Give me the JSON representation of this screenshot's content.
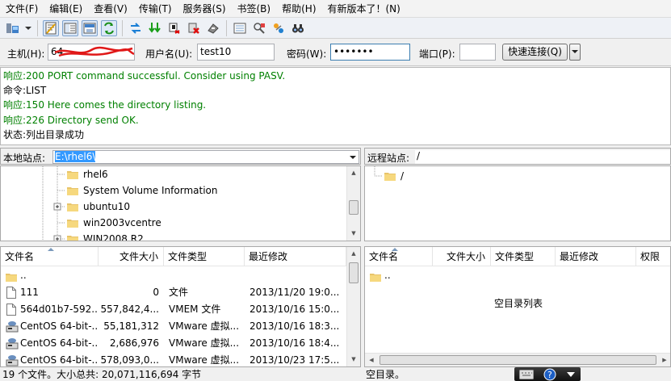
{
  "menu": [
    "文件(F)",
    "编辑(E)",
    "查看(V)",
    "传输(T)",
    "服务器(S)",
    "书签(B)",
    "帮助(H)",
    "有新版本了！(N)"
  ],
  "quickconnect": {
    "host_label": "主机(H):",
    "host_value": "64.",
    "user_label": "用户名(U):",
    "user_value": "test10",
    "pass_label": "密码(W):",
    "pass_value": "•••••••",
    "port_label": "端口(P):",
    "port_value": "",
    "connect_label": "快速连接(Q)"
  },
  "log": [
    {
      "prefix": "响应:",
      "text": "200 PORT command successful. Consider using PASV.",
      "color": "#008000"
    },
    {
      "prefix": "命令:",
      "text": "LIST",
      "color": "#000000"
    },
    {
      "prefix": "响应:",
      "text": "150 Here comes the directory listing.",
      "color": "#008000"
    },
    {
      "prefix": "响应:",
      "text": "226 Directory send OK.",
      "color": "#008000"
    },
    {
      "prefix": "状态:",
      "text": "列出目录成功",
      "color": "#000000"
    }
  ],
  "local": {
    "site_label": "本地站点:",
    "site_path": "E:\\rhel6\\",
    "tree": [
      "rhel6",
      "System Volume Information",
      "ubuntu10",
      "win2003vcentre",
      "WIN2008 R2"
    ],
    "columns": [
      "文件名",
      "文件大小",
      "文件类型",
      "最近修改"
    ],
    "files": [
      {
        "name": "..",
        "size": "",
        "type": "",
        "modified": "",
        "icon": "folder-icon"
      },
      {
        "name": "111",
        "size": "0",
        "type": "文件",
        "modified": "2013/11/20 19:0...",
        "icon": "file-icon"
      },
      {
        "name": "564d01b7-592...",
        "size": "557,842,4...",
        "type": "VMEM 文件",
        "modified": "2013/10/16 15:0...",
        "icon": "file-icon"
      },
      {
        "name": "CentOS 64-bit-...",
        "size": "55,181,312",
        "type": "VMware 虚拟...",
        "modified": "2013/10/16 18:3...",
        "icon": "vmware-disk-icon"
      },
      {
        "name": "CentOS 64-bit-...",
        "size": "2,686,976",
        "type": "VMware 虚拟...",
        "modified": "2013/10/16 18:4...",
        "icon": "vmware-disk-icon"
      },
      {
        "name": "CentOS 64-bit-...",
        "size": "578,093,0...",
        "type": "VMware 虚拟...",
        "modified": "2013/10/23 17:5...",
        "icon": "vmware-disk-icon"
      }
    ],
    "status": "19 个文件。大小总共: 20,071,116,694 字节"
  },
  "remote": {
    "site_label": "远程站点:",
    "site_path": "/",
    "tree": [
      "/"
    ],
    "columns": [
      "文件名",
      "文件大小",
      "文件类型",
      "最近修改",
      "权限"
    ],
    "files": [
      {
        "name": "..",
        "icon": "folder-icon"
      }
    ],
    "empty_text": "空目录列表",
    "status": "空目录。"
  }
}
